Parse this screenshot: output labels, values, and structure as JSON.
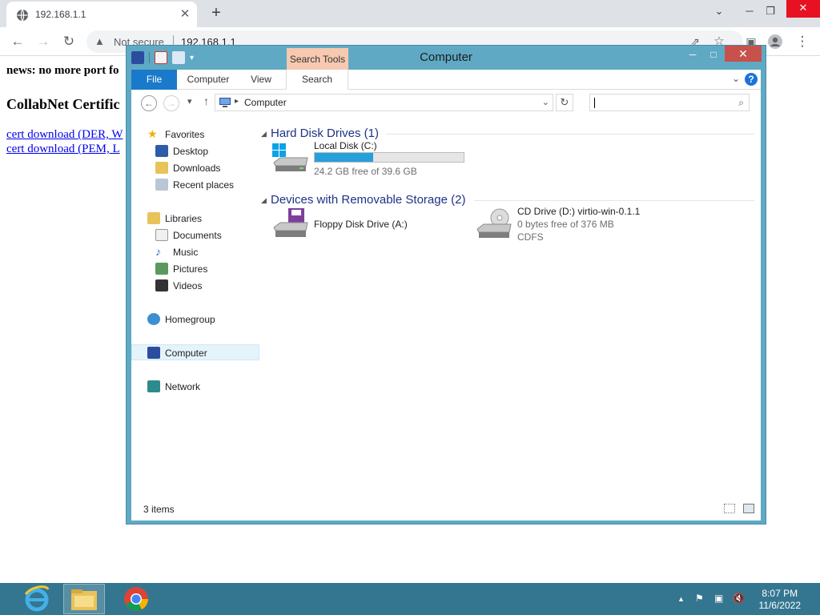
{
  "browser": {
    "tab_title": "192.168.1.1",
    "tab_close": "✕",
    "new_tab": "+",
    "security_label": "Not secure",
    "url": "192.168.1.1"
  },
  "page": {
    "news": "news: no more port fo",
    "heading": "CollabNet Certific",
    "links": [
      "cert download (DER, W",
      "cert download (PEM, L"
    ]
  },
  "explorer": {
    "title": "Computer",
    "context_tab_group": "Search Tools",
    "ribbon_tabs": [
      "File",
      "Computer",
      "View",
      "Search"
    ],
    "address_crumb": "Computer",
    "search_placeholder": "",
    "nav_pane": {
      "favorites": {
        "label": "Favorites",
        "items": [
          "Desktop",
          "Downloads",
          "Recent places"
        ]
      },
      "libraries": {
        "label": "Libraries",
        "items": [
          "Documents",
          "Music",
          "Pictures",
          "Videos"
        ]
      },
      "homegroup": "Homegroup",
      "computer": "Computer",
      "network": "Network"
    },
    "groups": {
      "hdd": {
        "header": "Hard Disk Drives (1)",
        "drives": [
          {
            "name": "Local Disk (C:)",
            "detail": "24.2 GB free of 39.6 GB",
            "used_fraction": 0.39
          }
        ]
      },
      "removable": {
        "header": "Devices with Removable Storage (2)",
        "drives": [
          {
            "name": "Floppy Disk Drive (A:)"
          },
          {
            "name": "CD Drive (D:) virtio-win-0.1.1",
            "detail": "0 bytes free of 376 MB",
            "fs": "CDFS"
          }
        ]
      }
    },
    "status": "3 items"
  },
  "taskbar": {
    "time": "8:07 PM",
    "date": "11/6/2022"
  },
  "colors": {
    "window_frame": "#5fa9c4",
    "taskbar": "#34768f",
    "ribbon_file_tab": "#1979ca",
    "context_tab": "#f7c9b0",
    "capacity_fill": "#26a0da",
    "close_button": "#c7514b"
  }
}
